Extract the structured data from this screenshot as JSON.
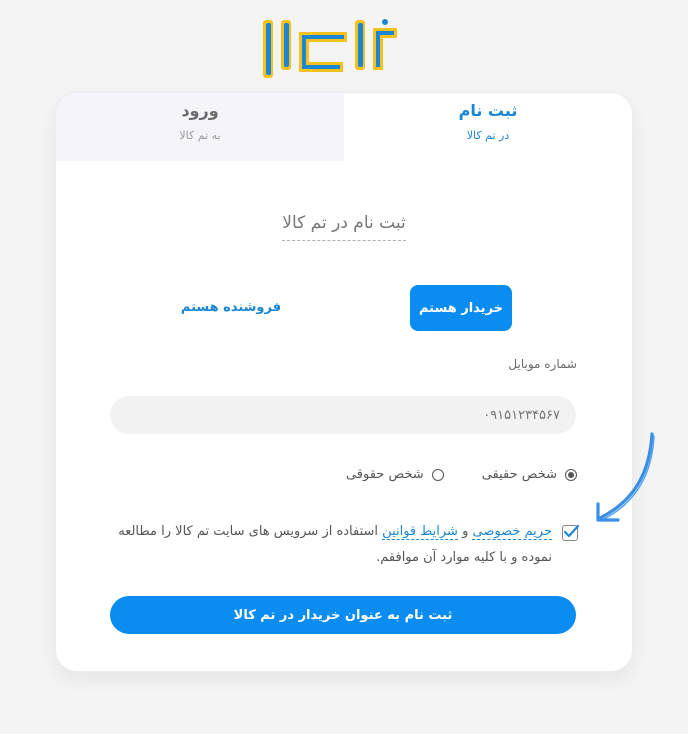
{
  "brand": {
    "logo_text": "تم کالا",
    "colors": {
      "blue": "#1b86d6",
      "yellow": "#f4c21c"
    }
  },
  "tabs": [
    {
      "title": "ثبت نام",
      "subtitle": "در تم کالا",
      "active": true
    },
    {
      "title": "ورود",
      "subtitle": "به تم کالا",
      "active": false
    }
  ],
  "heading": "ثبت نام در تم کالا",
  "roles": {
    "buyer": "خریدار هستم",
    "seller": "فروشنده هستم",
    "selected": "buyer"
  },
  "mobile": {
    "label": "شماره موبایل",
    "placeholder": "۰۹۱۵۱۲۳۴۵۶۷",
    "value": ""
  },
  "person_type": {
    "options": [
      {
        "label": "شخص حقیقی",
        "checked": true
      },
      {
        "label": "شخص حقوقی",
        "checked": false
      }
    ]
  },
  "terms": {
    "checked": true,
    "link_privacy": "حریم خصوصی",
    "conjunction": "و",
    "link_rules": "شرایط قوانین",
    "text_after": "استفاده از سرویس های سایت تم کالا را مطالعه نموده و با کلیه موارد آن موافقم."
  },
  "submit_label": "ثبت نام به عنوان خریدار در تم کالا",
  "theme": {
    "primary": "#0a8cf0",
    "background": "#f4f4f5",
    "inactive_tab": "#f4f4f9"
  },
  "icons": {
    "pointer_arrow": "hand-drawn-arrow-icon",
    "checkbox": "check-icon"
  }
}
